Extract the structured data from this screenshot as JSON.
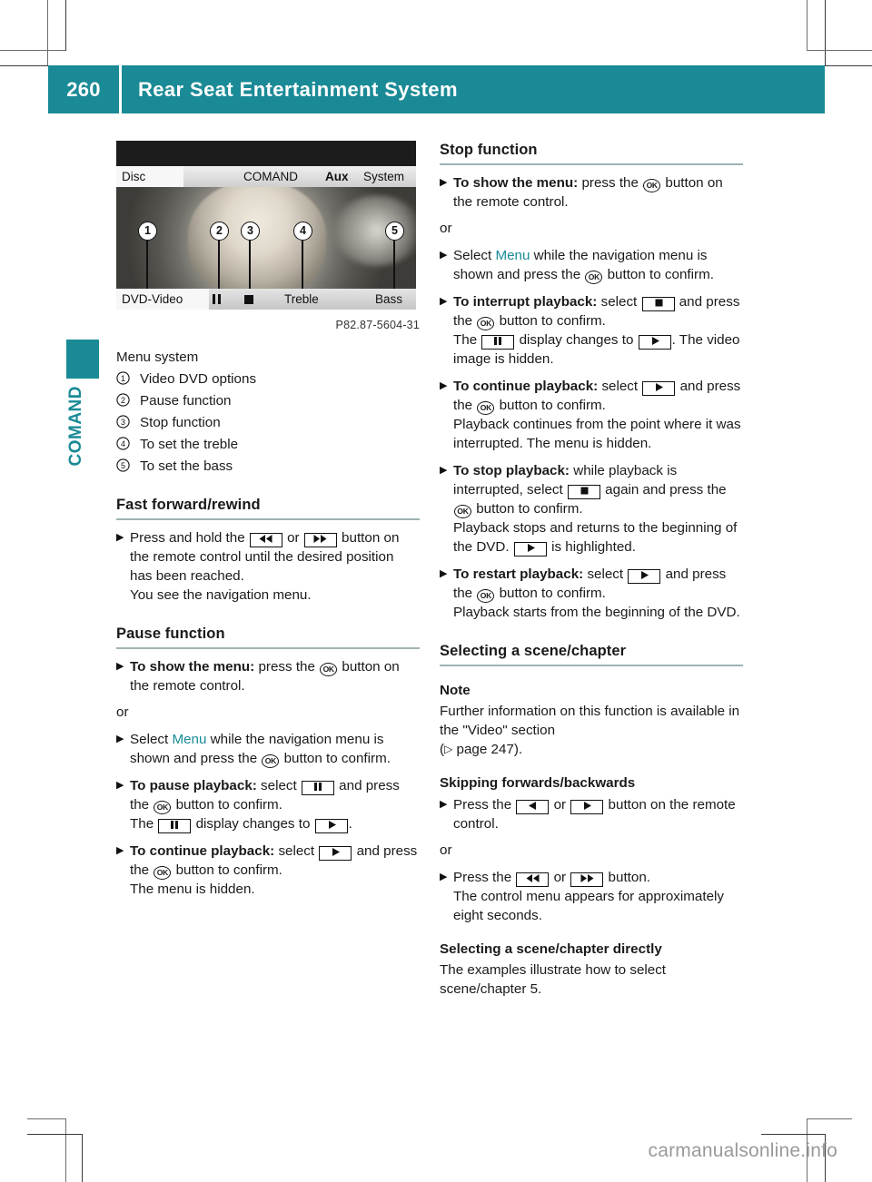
{
  "header": {
    "page_number": "260",
    "title": "Rear Seat Entertainment System",
    "accent_color": "#1a8a96"
  },
  "side_tab": {
    "label": "COMAND"
  },
  "figure": {
    "caption": "P82.87-5604-31",
    "menu_bar": [
      "Disc",
      "COMAND",
      "Aux",
      "System"
    ],
    "bottom_bar": [
      "DVD-Video",
      "pause-glyph",
      "stop-glyph",
      "Treble",
      "Bass"
    ],
    "callouts": [
      "1",
      "2",
      "3",
      "4",
      "5"
    ]
  },
  "left_column": {
    "legend_title": "Menu system",
    "legend": [
      {
        "num": "\u0003",
        "marker": "1",
        "text": "Video DVD options"
      },
      {
        "num": "\u0004",
        "marker": "2",
        "text": "Pause function"
      },
      {
        "num": "\u0005",
        "marker": "3",
        "text": "Stop function"
      },
      {
        "num": "\u0006",
        "marker": "4",
        "text": "To set the treble"
      },
      {
        "num": "\u0007",
        "marker": "5",
        "text": "To set the bass"
      }
    ],
    "sections": [
      {
        "heading": "Fast forward/rewind",
        "steps": [
          {
            "prefix": "Press and hold the ",
            "key1": "rewind",
            "mid": " or ",
            "key2": "forward",
            "suffix": " button on the remote control until the desired position has been reached.",
            "extra": "You see the navigation menu."
          }
        ]
      },
      {
        "heading": "Pause function",
        "steps": [
          {
            "bold": "To show the menu:",
            "text_a": " press the ",
            "ok": true,
            "text_b": " button on the remote control."
          },
          {
            "or": "or"
          },
          {
            "select_menu": true,
            "text_a": "Select ",
            "menu_word": "Menu",
            "text_b": " while the navigation menu is shown and press the ",
            "ok": true,
            "text_c": " button to confirm."
          },
          {
            "bold": "To pause playback:",
            "text_a": " select ",
            "key": "pause",
            "text_b": " and press the ",
            "ok": true,
            "text_c": " button to confirm.",
            "line2_a": "The ",
            "line2_key": "pause",
            "line2_b": " display changes to ",
            "line2_key2": "play",
            "line2_c": "."
          },
          {
            "bold": "To continue playback:",
            "text_a": " select ",
            "key": "play",
            "text_b": " and press the ",
            "ok": true,
            "text_c": " button to confirm.",
            "line2": "The menu is hidden."
          }
        ]
      }
    ]
  },
  "right_column": {
    "sections": [
      {
        "heading": "Stop function",
        "steps": [
          {
            "bold": "To show the menu:",
            "text_a": " press the ",
            "ok": true,
            "text_b": " button on the remote control."
          },
          {
            "or": "or"
          },
          {
            "text_a": "Select ",
            "menu_word": "Menu",
            "text_b": " while the navigation menu is shown and press the ",
            "ok": true,
            "text_c": " button to confirm."
          },
          {
            "bold": "To interrupt playback:",
            "text_a": " select ",
            "key": "stop",
            "text_b": " and press the ",
            "ok": true,
            "text_c": " button to confirm.",
            "line2_a": "The ",
            "line2_key": "pause",
            "line2_b": " display changes to ",
            "line2_key2": "play",
            "line2_c": ". The video image is hidden."
          },
          {
            "bold": "To continue playback:",
            "text_a": " select ",
            "key": "play",
            "text_b": " and press the ",
            "ok": true,
            "text_c": " button to confirm.",
            "line2": "Playback continues from the point where it was interrupted. The menu is hidden."
          },
          {
            "bold": "To stop playback:",
            "text_a": " while playback is interrupted, select ",
            "key": "stop",
            "text_b": " again and press the ",
            "ok": true,
            "text_c": " button to confirm.",
            "line2_a": "Playback stops and returns to the beginning of the DVD. ",
            "line2_key": "play",
            "line2_b": " is highlighted."
          },
          {
            "bold": "To restart playback:",
            "text_a": " select ",
            "key": "play",
            "text_b": " and press the ",
            "ok": true,
            "text_c": " button to confirm.",
            "line2": "Playback starts from the beginning of the DVD."
          }
        ]
      },
      {
        "heading": "Selecting a scene/chapter",
        "note_heading": "Note",
        "note_text_a": "Further information on this function is available in the \"Video\" section",
        "note_text_b": "page 247).",
        "sub1": "Skipping forwards/backwards",
        "sub1_steps": [
          {
            "text_a": "Press the ",
            "key1": "left",
            "mid": " or ",
            "key2": "right",
            "text_b": " button on the remote control."
          },
          {
            "or": "or"
          },
          {
            "text_a": "Press the ",
            "key1": "rewind",
            "mid": " or ",
            "key2": "forward",
            "text_b": " button.",
            "line2": "The control menu appears for approximately eight seconds."
          }
        ],
        "sub2": "Selecting a scene/chapter directly",
        "sub2_text": "The examples illustrate how to select scene/chapter 5."
      }
    ]
  },
  "watermark": "carmanualsonline.info"
}
